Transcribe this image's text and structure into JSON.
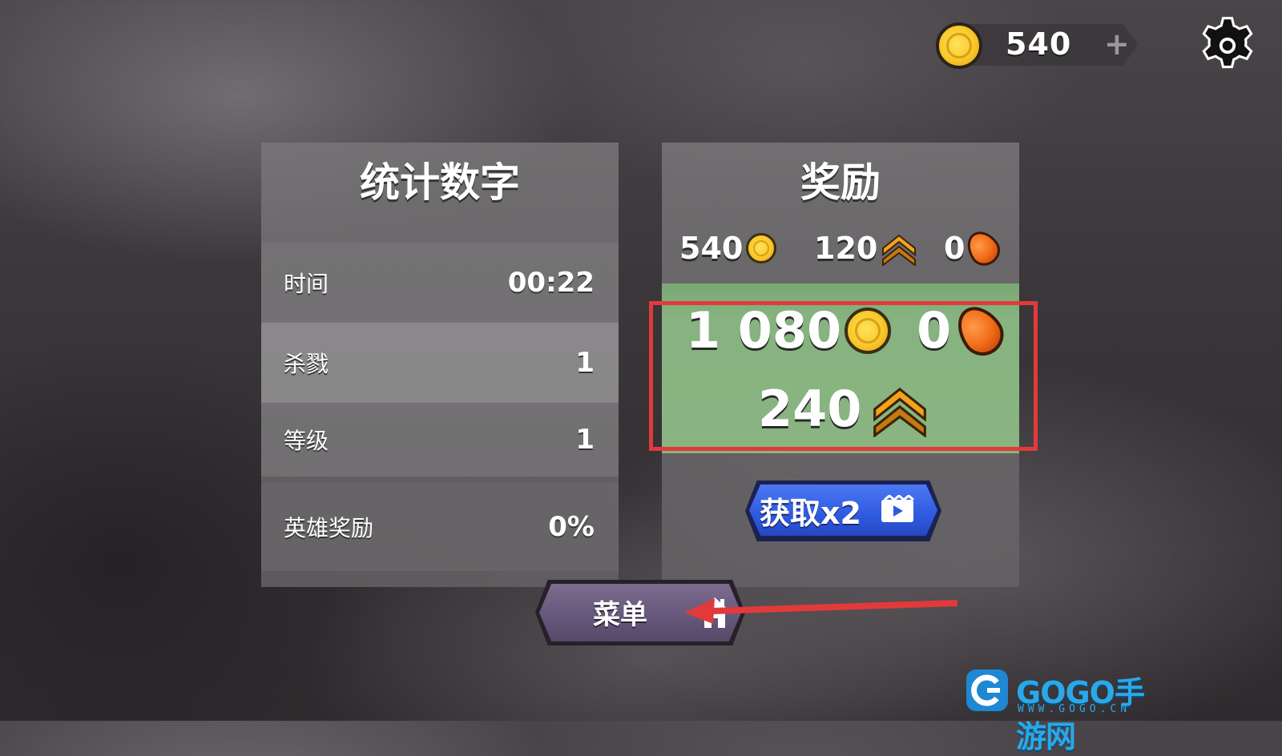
{
  "topbar": {
    "coins": "540",
    "plus": "+",
    "icons": {
      "coin": "coin-icon",
      "settings": "gear-icon"
    }
  },
  "stats": {
    "title": "统计数字",
    "rows": [
      {
        "label": "时间",
        "value": "00:22"
      },
      {
        "label": "杀戮",
        "value": "1"
      },
      {
        "label": "等级",
        "value": "1"
      },
      {
        "label": "英雄奖励",
        "value": "0%"
      }
    ]
  },
  "rewards": {
    "title": "奖励",
    "base": {
      "coins": "540",
      "xp": "120",
      "gems": "0"
    },
    "total": {
      "coins": "1 080",
      "gems": "0",
      "xp": "240"
    },
    "double_button": "获取x2"
  },
  "menu_button": "菜单",
  "colors": {
    "highlight_frame": "#e23a3a",
    "double_button": "#2f5ae0",
    "menu_button": "#65577a",
    "reward_green": "#86b37f"
  },
  "watermark": {
    "brand": "GOGO手游网",
    "url": "WWW.GOGO.CN"
  }
}
